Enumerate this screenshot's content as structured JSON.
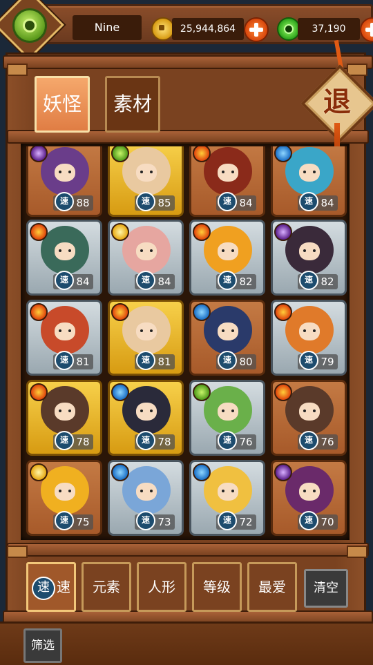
{
  "header": {
    "player_name": "Nine",
    "gold_amount": "25,944,864",
    "jade_amount": "37,190"
  },
  "exit": {
    "label": "退"
  },
  "tabs": [
    {
      "label": "妖怪",
      "active": true
    },
    {
      "label": "素材",
      "active": false
    }
  ],
  "cards": [
    {
      "element": "dark",
      "rarity": "brown",
      "speed": "88",
      "portrait_color": "#6a3d8a"
    },
    {
      "element": "grass",
      "rarity": "gold",
      "speed": "85",
      "portrait_color": "#e9c9a0"
    },
    {
      "element": "fire",
      "rarity": "brown",
      "speed": "84",
      "portrait_color": "#8a2a1a"
    },
    {
      "element": "water",
      "rarity": "brown",
      "speed": "84",
      "portrait_color": "#3aa6c8"
    },
    {
      "element": "fire",
      "rarity": "silver",
      "speed": "84",
      "portrait_color": "#3a6a5a"
    },
    {
      "element": "light",
      "rarity": "silver",
      "speed": "84",
      "portrait_color": "#e6a6a0"
    },
    {
      "element": "fire",
      "rarity": "silver",
      "speed": "82",
      "portrait_color": "#f0a020"
    },
    {
      "element": "dark",
      "rarity": "silver",
      "speed": "82",
      "portrait_color": "#3a2a3a"
    },
    {
      "element": "fire",
      "rarity": "silver",
      "speed": "81",
      "portrait_color": "#c84a2a"
    },
    {
      "element": "fire",
      "rarity": "gold",
      "speed": "81",
      "portrait_color": "#e9c9a0"
    },
    {
      "element": "water",
      "rarity": "brown",
      "speed": "80",
      "portrait_color": "#2a3a6a"
    },
    {
      "element": "fire",
      "rarity": "silver",
      "speed": "79",
      "portrait_color": "#e07a2a"
    },
    {
      "element": "fire",
      "rarity": "gold",
      "speed": "78",
      "portrait_color": "#5a3a2a"
    },
    {
      "element": "water",
      "rarity": "gold",
      "speed": "78",
      "portrait_color": "#2a2a3a"
    },
    {
      "element": "grass",
      "rarity": "silver",
      "speed": "76",
      "portrait_color": "#6ab04a"
    },
    {
      "element": "fire",
      "rarity": "brown",
      "speed": "76",
      "portrait_color": "#5a3a2a"
    },
    {
      "element": "light",
      "rarity": "brown",
      "speed": "75",
      "portrait_color": "#f0b020"
    },
    {
      "element": "water",
      "rarity": "silver",
      "speed": "73",
      "portrait_color": "#7aa6d8"
    },
    {
      "element": "water",
      "rarity": "silver",
      "speed": "72",
      "portrait_color": "#f0c040"
    },
    {
      "element": "dark",
      "rarity": "brown",
      "speed": "70",
      "portrait_color": "#6a2a6a"
    }
  ],
  "speed_icon_label": "速",
  "filters": [
    {
      "icon": "速",
      "label": "速",
      "active": true
    },
    {
      "icon": "",
      "label": "元素",
      "active": false
    },
    {
      "icon": "",
      "label": "人形",
      "active": false
    },
    {
      "icon": "",
      "label": "等级",
      "active": false
    },
    {
      "icon": "",
      "label": "最爱",
      "active": false
    }
  ],
  "clear_button": "清空",
  "filter_button": "筛选"
}
